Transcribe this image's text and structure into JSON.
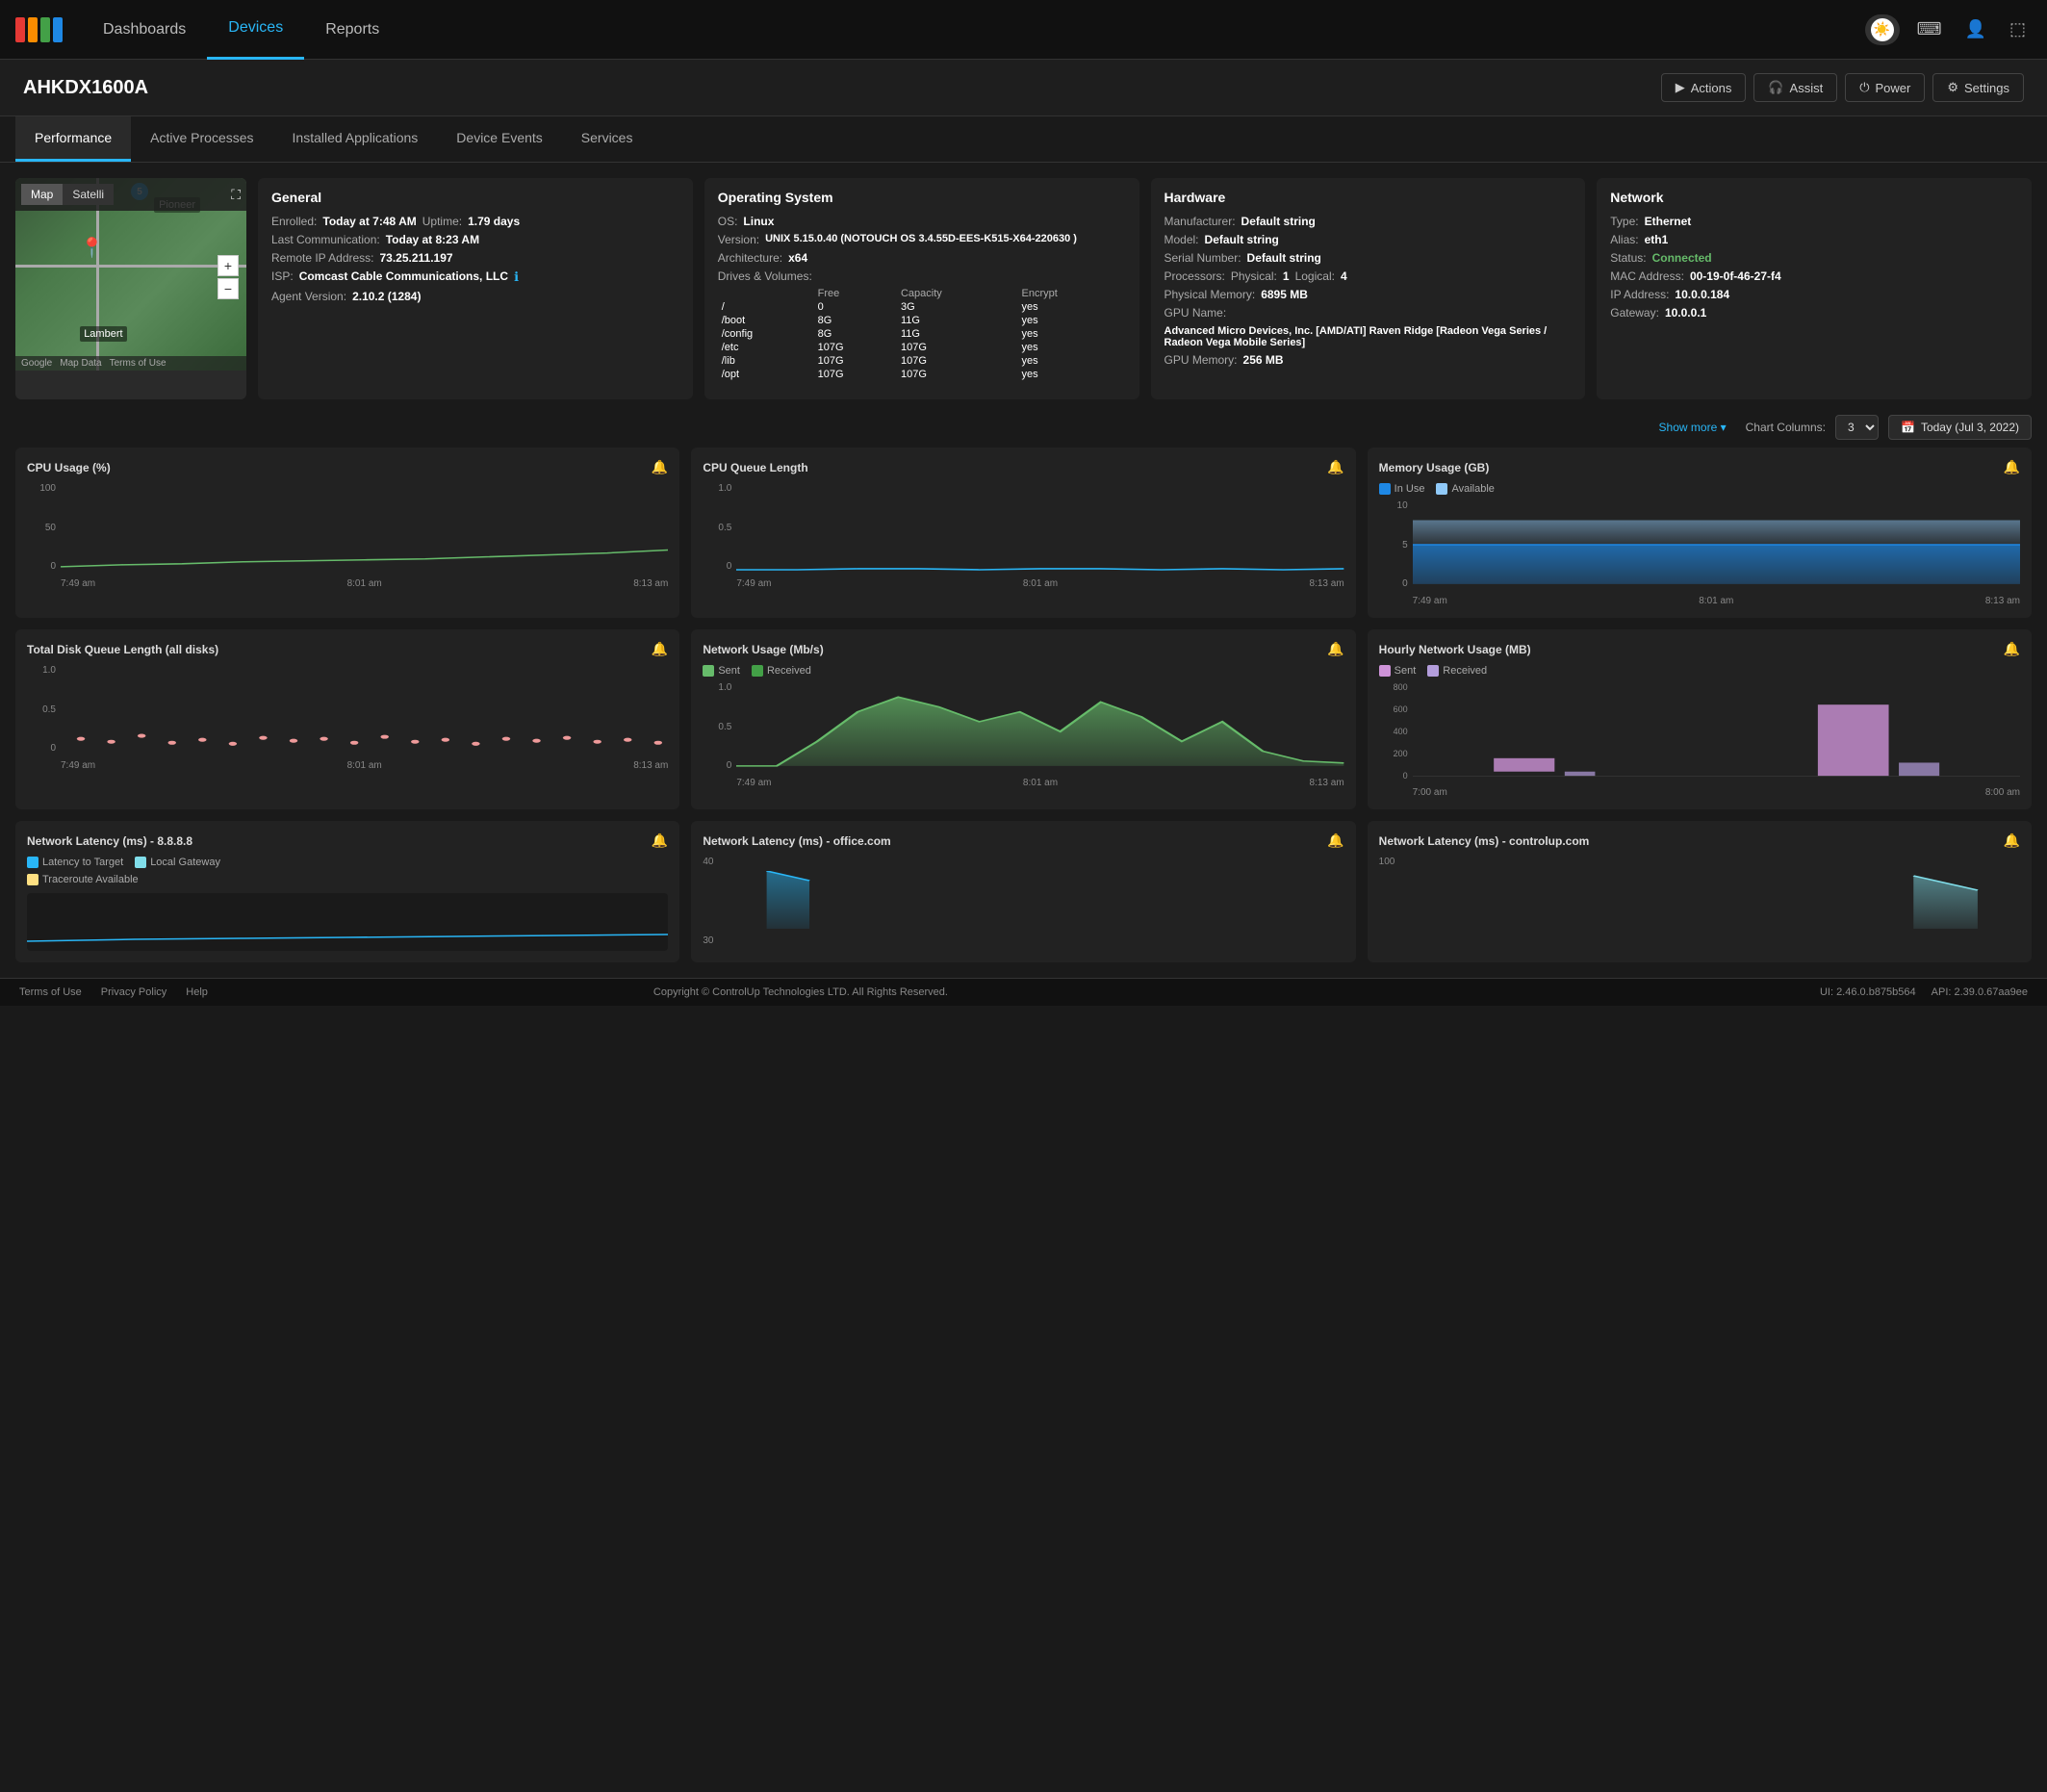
{
  "nav": {
    "items": [
      "Dashboards",
      "Devices",
      "Reports"
    ],
    "active": "Devices"
  },
  "device": {
    "title": "AHKDX1600A",
    "actions": [
      "Actions",
      "Assist",
      "Power",
      "Settings"
    ]
  },
  "tabs": [
    "Performance",
    "Active Processes",
    "Installed Applications",
    "Device Events",
    "Services"
  ],
  "active_tab": "Performance",
  "general": {
    "title": "General",
    "enrolled_label": "Enrolled:",
    "enrolled_value": "Today at 7:48 AM",
    "uptime_label": "Uptime:",
    "uptime_value": "1.79 days",
    "last_comm_label": "Last Communication:",
    "last_comm_value": "Today at 8:23 AM",
    "remote_ip_label": "Remote IP Address:",
    "remote_ip_value": "73.25.211.197",
    "isp_label": "ISP:",
    "isp_value": "Comcast Cable Communications, LLC",
    "agent_label": "Agent Version:",
    "agent_value": "2.10.2 (1284)"
  },
  "os": {
    "title": "Operating System",
    "os_label": "OS:",
    "os_value": "Linux",
    "version_label": "Version:",
    "version_value": "UNIX 5.15.0.40 (NOTOUCH OS 3.4.55D-EES-K515-X64-220630 )",
    "arch_label": "Architecture:",
    "arch_value": "x64",
    "drives_title": "Drives & Volumes:",
    "drives_headers": [
      "",
      "Free",
      "Capacity",
      "Encrypt"
    ],
    "drives": [
      [
        "/",
        "0",
        "3G",
        "yes"
      ],
      [
        "/boot",
        "8G",
        "11G",
        "yes"
      ],
      [
        "/config",
        "8G",
        "11G",
        "yes"
      ],
      [
        "/etc",
        "107G",
        "107G",
        "yes"
      ],
      [
        "/lib",
        "107G",
        "107G",
        "yes"
      ],
      [
        "/opt",
        "107G",
        "107G",
        "yes"
      ]
    ]
  },
  "hardware": {
    "title": "Hardware",
    "manufacturer_label": "Manufacturer:",
    "manufacturer_value": "Default string",
    "model_label": "Model:",
    "model_value": "Default string",
    "serial_label": "Serial Number:",
    "serial_value": "Default string",
    "processors_label": "Processors:",
    "physical_label": "Physical:",
    "physical_value": "1",
    "logical_label": "Logical:",
    "logical_value": "4",
    "phys_memory_label": "Physical Memory:",
    "phys_memory_value": "6895 MB",
    "gpu_name_label": "GPU Name:",
    "gpu_name_value": "Advanced Micro Devices, Inc. [AMD/ATI] Raven Ridge [Radeon Vega Series / Radeon Vega Mobile Series]",
    "gpu_memory_label": "GPU Memory:",
    "gpu_memory_value": "256 MB"
  },
  "network": {
    "title": "Network",
    "type_label": "Type:",
    "type_value": "Ethernet",
    "alias_label": "Alias:",
    "alias_value": "eth1",
    "status_label": "Status:",
    "status_value": "Connected",
    "mac_label": "MAC Address:",
    "mac_value": "00-19-0f-46-27-f4",
    "ip_label": "IP Address:",
    "ip_value": "10.0.0.184",
    "gateway_label": "Gateway:",
    "gateway_value": "10.0.0.1"
  },
  "chart_controls": {
    "columns_label": "Chart Columns:",
    "columns_value": "3",
    "date_label": "Today (Jul 3, 2022)"
  },
  "charts": [
    {
      "id": "cpu-usage",
      "title": "CPU Usage (%)",
      "y_max": "100",
      "y_mid": "50",
      "y_min": "0",
      "x_labels": [
        "7:49 am",
        "8:01 am",
        "8:13 am"
      ],
      "color": "#66bb6a",
      "type": "line"
    },
    {
      "id": "cpu-queue",
      "title": "CPU Queue Length",
      "y_max": "1.0",
      "y_mid": "0.5",
      "y_min": "0",
      "x_labels": [
        "7:49 am",
        "8:01 am",
        "8:13 am"
      ],
      "color": "#29b6f6",
      "type": "line"
    },
    {
      "id": "memory-usage",
      "title": "Memory Usage (GB)",
      "y_max": "10",
      "y_mid": "5",
      "y_min": "0",
      "x_labels": [
        "7:49 am",
        "8:01 am",
        "8:13 am"
      ],
      "legend": [
        {
          "label": "In Use",
          "color": "#1e88e5"
        },
        {
          "label": "Available",
          "color": "#90caf9"
        }
      ],
      "type": "area"
    },
    {
      "id": "disk-queue",
      "title": "Total Disk Queue Length (all disks)",
      "y_max": "1.0",
      "y_mid": "0.5",
      "y_min": "0",
      "x_labels": [
        "7:49 am",
        "8:01 am",
        "8:13 am"
      ],
      "color": "#ef9a9a",
      "type": "scatter"
    },
    {
      "id": "network-usage-mbps",
      "title": "Network Usage (Mb/s)",
      "y_max": "1.0",
      "y_mid": "0.5",
      "y_min": "0",
      "x_labels": [
        "7:49 am",
        "8:01 am",
        "8:13 am"
      ],
      "legend": [
        {
          "label": "Sent",
          "color": "#66bb6a"
        },
        {
          "label": "Received",
          "color": "#43a047"
        }
      ],
      "type": "area"
    },
    {
      "id": "hourly-network-usage",
      "title": "Hourly Network Usage (MB)",
      "y_max": "800",
      "y_labels": [
        "800",
        "600",
        "400",
        "200",
        "0"
      ],
      "x_labels": [
        "7:00 am",
        "8:00 am"
      ],
      "legend": [
        {
          "label": "Sent",
          "color": "#ce93d8"
        },
        {
          "label": "Received",
          "color": "#b39ddb"
        }
      ],
      "type": "bar"
    }
  ],
  "latency_charts": [
    {
      "title": "Network Latency (ms) - 8.8.8.8",
      "y_max": "",
      "legend": [
        {
          "label": "Latency to Target",
          "color": "#29b6f6"
        },
        {
          "label": "Local Gateway",
          "color": "#80deea"
        },
        {
          "label": "Traceroute Available",
          "color": "#ffe082"
        }
      ]
    },
    {
      "title": "Network Latency (ms) - office.com",
      "y_max": "40",
      "y_mid": "30",
      "legend": []
    },
    {
      "title": "Network Latency (ms) - controlup.com",
      "y_max": "100",
      "legend": []
    }
  ],
  "footer": {
    "links": [
      "Terms of Use",
      "Privacy Policy",
      "Help"
    ],
    "copyright": "Copyright © ControlUp Technologies LTD. All Rights Reserved.",
    "ui_version": "UI: 2.46.0.b875b564",
    "api_version": "API: 2.39.0.67aa9ee"
  },
  "show_more": "Show more"
}
